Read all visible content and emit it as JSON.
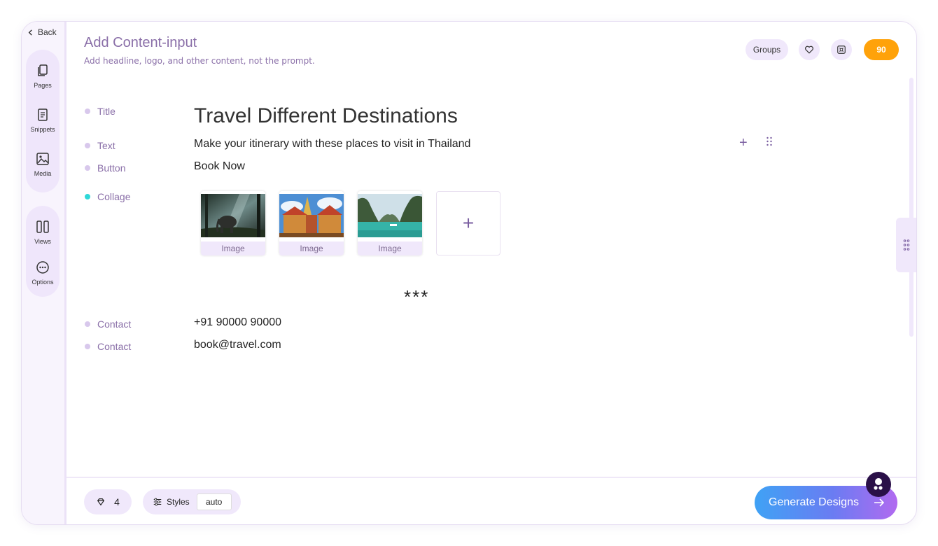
{
  "sidebar": {
    "back_label": "Back",
    "items": [
      {
        "label": "Pages",
        "icon": "pages-icon"
      },
      {
        "label": "Snippets",
        "icon": "snippets-icon"
      },
      {
        "label": "Media",
        "icon": "media-icon"
      },
      {
        "label": "Views",
        "icon": "views-icon"
      },
      {
        "label": "Options",
        "icon": "options-icon"
      }
    ]
  },
  "header": {
    "title": "Add Content-input",
    "subtitle": "Add headline, logo, and other content, not the prompt.",
    "groups_label": "Groups",
    "credits": "90"
  },
  "content": {
    "rows": [
      {
        "label": "Title",
        "value": "Travel Different Destinations"
      },
      {
        "label": "Text",
        "value": "Make your itinerary with these places to visit in Thailand"
      },
      {
        "label": "Button",
        "value": "Book Now"
      },
      {
        "label": "Collage",
        "value": ""
      },
      {
        "label": "Contact",
        "value": "+91 90000 90000"
      },
      {
        "label": "Contact",
        "value": "book@travel.com"
      }
    ],
    "collage_captions": [
      "Image",
      "Image",
      "Image"
    ],
    "divider": "***"
  },
  "footer": {
    "gems_count": "4",
    "styles_label": "Styles",
    "styles_value": "auto",
    "generate_label": "Generate Designs"
  },
  "colors": {
    "accent": "#8a6fa8",
    "credits": "#ffa20a",
    "pill_bg": "#f0e8fb",
    "active_dot": "#2fd8d8"
  }
}
